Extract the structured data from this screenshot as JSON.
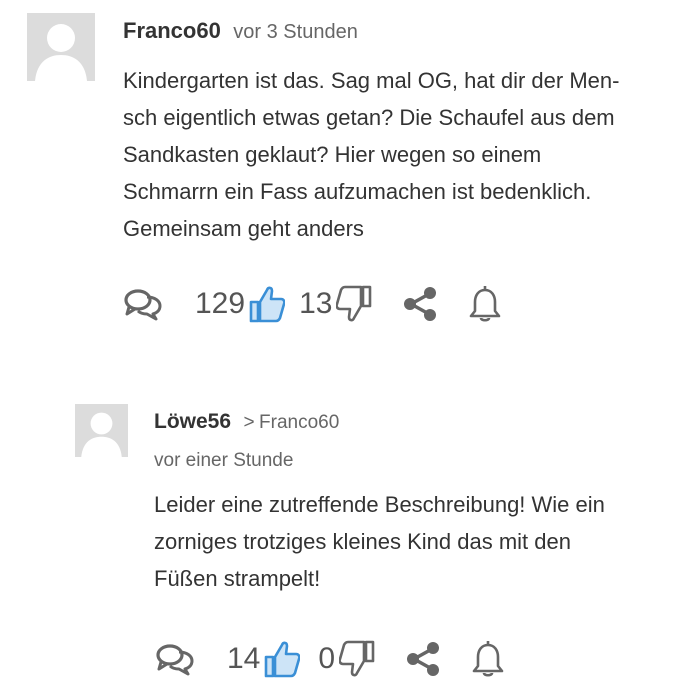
{
  "comments": [
    {
      "username": "Franco60",
      "timestamp": "vor 3 Stunden",
      "text": "Kindergarten ist das. Sag mal OG, hat dir der Men-\nsch eigentlich etwas getan? Die Schaufel aus dem\nSandkasten geklaut? Hier wegen so einem\nSchmarrn ein Fass aufzumachen ist bedenklich.\nGemeinsam geht anders",
      "likes": "129",
      "dislikes": "13",
      "icons": [
        "reply-icon",
        "thumbs-up-icon",
        "thumbs-down-icon",
        "share-icon",
        "bell-icon"
      ]
    },
    {
      "username": "Löwe56",
      "reply_to": "Franco60",
      "timestamp": "vor einer Stunde",
      "text": "Leider eine zutreffende Beschreibung! Wie ein\nzorniges trotziges kleines Kind das mit den\nFüßen strampelt!",
      "likes": "14",
      "dislikes": "0",
      "icons": [
        "reply-icon",
        "thumbs-up-icon",
        "thumbs-down-icon",
        "share-icon",
        "bell-icon"
      ]
    }
  ],
  "colors": {
    "like_blue": "#3a8fd6",
    "icon_gray": "#666666",
    "avatar_bg": "#dcdcdc"
  }
}
